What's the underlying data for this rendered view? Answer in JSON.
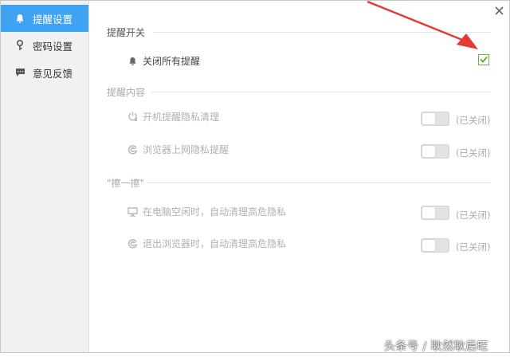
{
  "sidebar": {
    "items": [
      {
        "label": "提醒设置",
        "icon": "bell-icon",
        "active": true
      },
      {
        "label": "密码设置",
        "icon": "key-icon",
        "active": false
      },
      {
        "label": "意见反馈",
        "icon": "chat-icon",
        "active": false
      }
    ]
  },
  "sections": {
    "switch": {
      "title": "提醒开关",
      "row": {
        "label": "关闭所有提醒",
        "icon": "bell-icon",
        "checked": true
      }
    },
    "content": {
      "title": "提醒内容",
      "rows": [
        {
          "label": "开机提醒隐私清理",
          "icon": "power-clean-icon",
          "status": "(已关闭)"
        },
        {
          "label": "浏览器上网隐私提醒",
          "icon": "browser-icon",
          "status": "(已关闭)"
        }
      ]
    },
    "wipe": {
      "title": "\"擦一擦\"",
      "rows": [
        {
          "label": "在电脑空闲时，自动清理高危隐私",
          "icon": "monitor-icon",
          "status": "(已关闭)"
        },
        {
          "label": "退出浏览器时，自动清理高危隐私",
          "icon": "browser-refresh-icon",
          "status": "(已关闭)"
        }
      ]
    }
  },
  "watermark": "头条号 / 耿然耿后旺",
  "colors": {
    "accent": "#3ea3f2",
    "check": "#6ab04c",
    "arrow": "#e53935"
  }
}
